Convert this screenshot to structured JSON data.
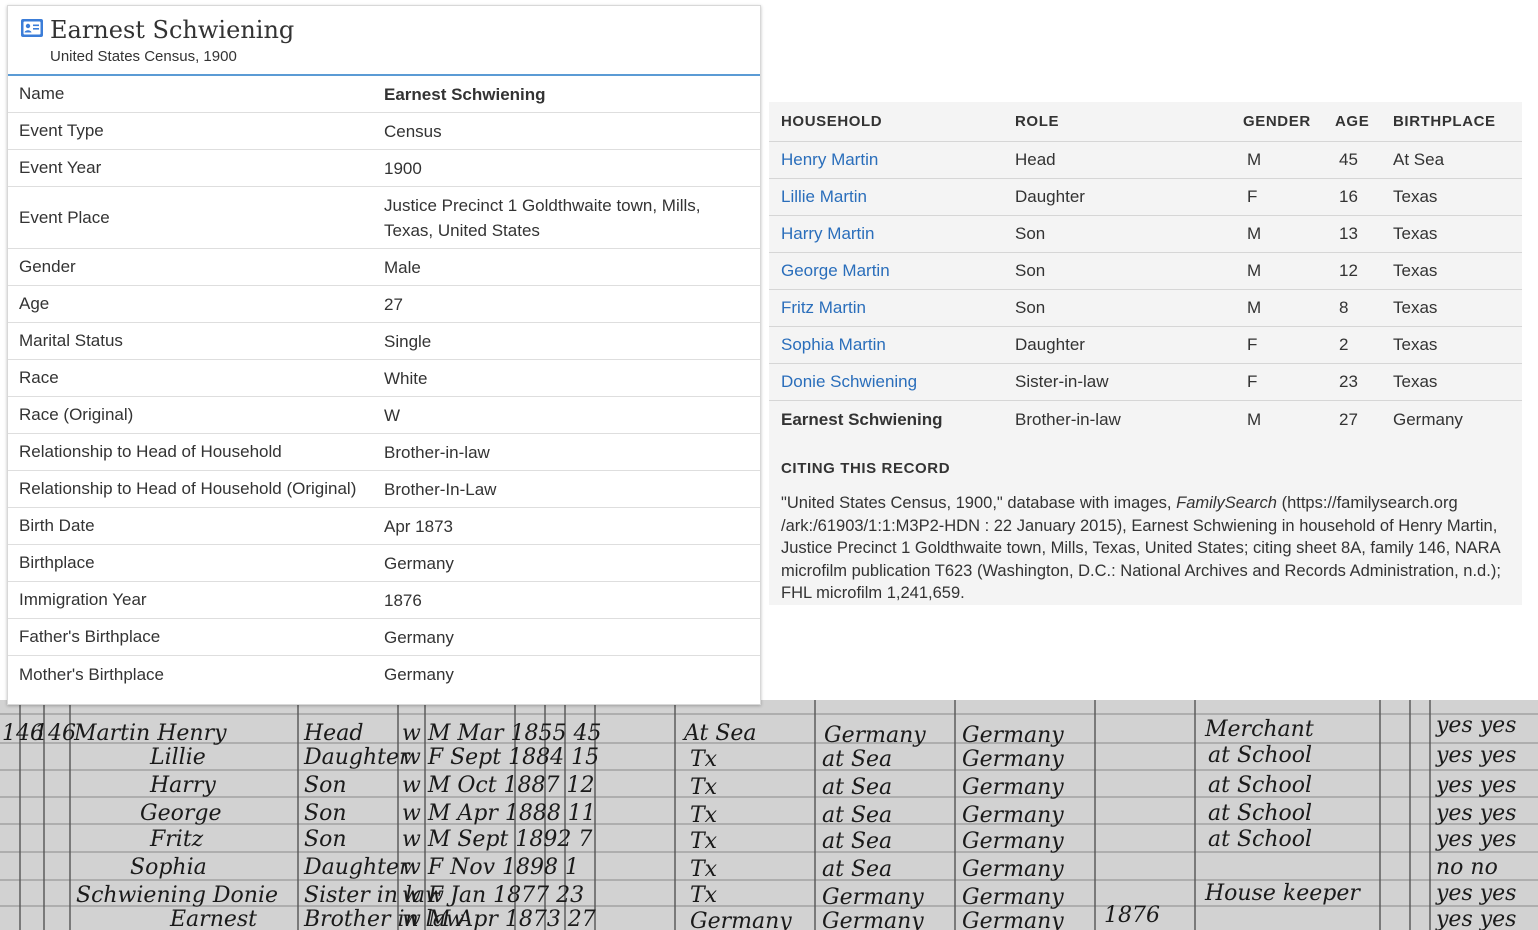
{
  "record": {
    "title": "Earnest Schwiening",
    "subtitle": "United States Census, 1900",
    "fields": [
      {
        "label": "Name",
        "value": "Earnest Schwiening"
      },
      {
        "label": "Event Type",
        "value": "Census"
      },
      {
        "label": "Event Year",
        "value": "1900"
      },
      {
        "label": "Event Place",
        "value": "Justice Precinct 1 Goldthwaite town, Mills, Texas, United States"
      },
      {
        "label": "Gender",
        "value": "Male"
      },
      {
        "label": "Age",
        "value": "27"
      },
      {
        "label": "Marital Status",
        "value": "Single"
      },
      {
        "label": "Race",
        "value": "White"
      },
      {
        "label": "Race (Original)",
        "value": "W"
      },
      {
        "label": "Relationship to Head of Household",
        "value": "Brother-in-law"
      },
      {
        "label": "Relationship to Head of Household (Original)",
        "value": "Brother-In-Law"
      },
      {
        "label": "Birth Date",
        "value": "Apr 1873"
      },
      {
        "label": "Birthplace",
        "value": "Germany"
      },
      {
        "label": "Immigration Year",
        "value": "1876"
      },
      {
        "label": "Father's Birthplace",
        "value": "Germany"
      },
      {
        "label": "Mother's Birthplace",
        "value": "Germany"
      }
    ]
  },
  "household": {
    "headers": {
      "household": "HOUSEHOLD",
      "role": "ROLE",
      "gender": "GENDER",
      "age": "AGE",
      "birthplace": "BIRTHPLACE"
    },
    "members": [
      {
        "name": "Henry Martin",
        "role": "Head",
        "gender": "M",
        "age": "45",
        "birthplace": "At Sea"
      },
      {
        "name": "Lillie Martin",
        "role": "Daughter",
        "gender": "F",
        "age": "16",
        "birthplace": "Texas"
      },
      {
        "name": "Harry Martin",
        "role": "Son",
        "gender": "M",
        "age": "13",
        "birthplace": "Texas"
      },
      {
        "name": "George Martin",
        "role": "Son",
        "gender": "M",
        "age": "12",
        "birthplace": "Texas"
      },
      {
        "name": "Fritz Martin",
        "role": "Son",
        "gender": "M",
        "age": "8",
        "birthplace": "Texas"
      },
      {
        "name": "Sophia Martin",
        "role": "Daughter",
        "gender": "F",
        "age": "2",
        "birthplace": "Texas"
      },
      {
        "name": "Donie Schwiening",
        "role": "Sister-in-law",
        "gender": "F",
        "age": "23",
        "birthplace": "Texas"
      },
      {
        "name": "Earnest Schwiening",
        "role": "Brother-in-law",
        "gender": "M",
        "age": "27",
        "birthplace": "Germany"
      }
    ]
  },
  "citing": {
    "label": "CITING THIS RECORD",
    "text_before": "\"United States Census, 1900,\" database with images, ",
    "text_italic": "FamilySearch",
    "text_after": " (https://familysearch.org /ark:/61903/1:1:M3P2-HDN : 22 January 2015), Earnest Schwiening in household of Henry Martin, Justice Precinct 1 Goldthwaite town, Mills, Texas, United States; citing sheet 8A, family 146, NARA microfilm publication T623 (Washington, D.C.: National Archives and Records Administration, n.d.); FHL microfilm 1,241,659."
  },
  "census_image": {
    "handwriting": [
      "146",
      "146",
      "Martin Henry",
      "Head",
      "w M Mar 1855 45",
      "At Sea",
      "Germany",
      "Germany",
      "Merchant",
      "yes yes",
      "Lillie",
      "Daughter",
      "w F Sept 1884 15",
      "Tx",
      "at Sea",
      "Germany",
      "at School",
      "yes yes",
      "Harry",
      "Son",
      "w M Oct 1887 12",
      "Tx",
      "at Sea",
      "Germany",
      "at School",
      "yes yes",
      "George",
      "Son",
      "w M Apr 1888 11",
      "Tx",
      "at Sea",
      "Germany",
      "at School",
      "yes yes",
      "Fritz",
      "Son",
      "w M Sept 1892 7",
      "Tx",
      "at Sea",
      "Germany",
      "at School",
      "yes yes",
      "Sophia",
      "Daughter",
      "w F Nov 1898 1",
      "Tx",
      "at Sea",
      "Germany",
      "no no",
      "Schwiening Donie",
      "Sister in law",
      "w F Jan 1877 23",
      "Tx",
      "Germany",
      "Germany",
      "House keeper",
      "yes yes",
      "Earnest",
      "Brother in law",
      "w M Apr 1873 27",
      "Germany",
      "Germany",
      "Germany",
      "1876",
      "yes yes"
    ]
  },
  "colors": {
    "link": "#2a6ebb",
    "header_accent": "#5b9bd5",
    "panel_bg": "#f4f4f4",
    "icon": "#3b7dd8"
  }
}
